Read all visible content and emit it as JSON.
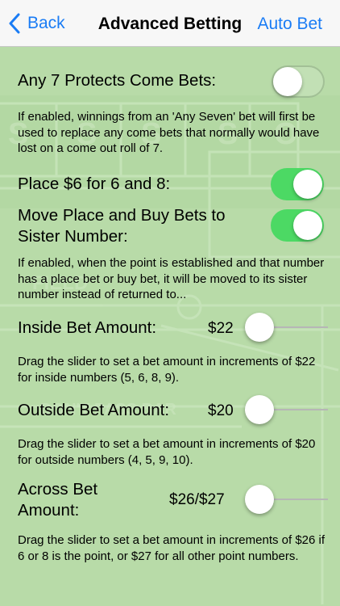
{
  "nav": {
    "back_label": "Back",
    "title": "Advanced Betting",
    "auto_bet_label": "Auto Bet"
  },
  "colors": {
    "accent": "#1a7cf5",
    "toggle_on": "#4cd964",
    "background": "#b9dcaa"
  },
  "settings": {
    "any7": {
      "label": "Any 7 Protects Come Bets:",
      "enabled": false,
      "description": "If enabled, winnings from an 'Any Seven' bet will first be used to replace any come bets that normally would have lost on a come out roll of 7."
    },
    "place68": {
      "label": "Place $6 for 6 and 8:",
      "enabled": true
    },
    "move_place": {
      "label_line1": "Move Place and Buy Bets to",
      "label_line2": "Sister Number:",
      "enabled": true,
      "description": "If enabled, when the point is established and that number has a place bet or buy bet, it will be moved to its sister number instead of returned to..."
    },
    "inside": {
      "label": "Inside Bet Amount:",
      "amount": "$22",
      "slider_fraction": 0,
      "description": "Drag the slider to set a bet amount in increments of $22 for inside numbers (5, 6, 8, 9)."
    },
    "outside": {
      "label": "Outside Bet Amount:",
      "amount": "$20",
      "slider_fraction": 0,
      "description": "Drag the slider to set a bet amount in increments of $20 for outside numbers (4, 5, 9, 10)."
    },
    "across": {
      "label_line1": "Across Bet",
      "label_line2": "Amount:",
      "amount": "$26/$27",
      "slider_fraction": 0,
      "description": "Drag the slider to set a bet amount in increments of $26 if 6 or 8 is the point, or $27 for all other point numbers."
    }
  }
}
